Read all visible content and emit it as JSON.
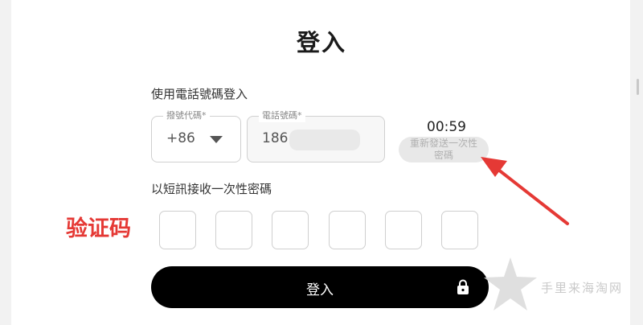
{
  "title": "登入",
  "subtitle": "使用電話號碼登入",
  "country_code": {
    "label": "撥號代碼*",
    "value": "+86"
  },
  "phone": {
    "label": "電話號碼*",
    "value": "186"
  },
  "timer": "00:59",
  "resend": {
    "line1": "重新發送一次性",
    "line2": "密碼"
  },
  "sms_label": "以短訊接收一次性密碼",
  "otp_annotation": "验证码",
  "otp_digits": [
    "",
    "",
    "",
    "",
    "",
    ""
  ],
  "login_button": "登入",
  "watermark": "手里来海淘网",
  "colors": {
    "annotation": "#e53935",
    "button": "#000000"
  }
}
